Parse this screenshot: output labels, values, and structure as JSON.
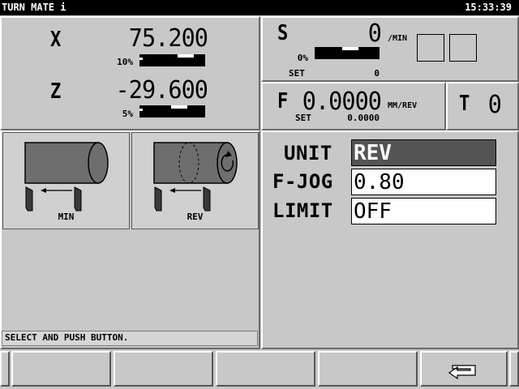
{
  "titlebar": {
    "app_title": "TURN MATE i",
    "clock": "15:33:39"
  },
  "position": {
    "x": {
      "label": "X",
      "value": "75.200",
      "override": "10%",
      "level": 0.7
    },
    "z": {
      "label": "Z",
      "value": "-29.600",
      "override": "5%",
      "level": 0.6
    }
  },
  "spindle": {
    "label": "S",
    "value": "0",
    "unit": "/MIN",
    "override": "0%",
    "set_label": "SET",
    "set_value": "0",
    "level": 0.55
  },
  "feed": {
    "label": "F",
    "value": "0.0000",
    "unit": "MM/REV",
    "set_label": "SET",
    "set_value": "0.0000"
  },
  "tool": {
    "label": "T",
    "value": "0"
  },
  "modes": [
    {
      "label": "MIN"
    },
    {
      "label": "REV"
    }
  ],
  "params": [
    {
      "label": "UNIT",
      "value": "REV"
    },
    {
      "label": "F-JOG",
      "value": "0.80"
    },
    {
      "label": "LIMIT",
      "value": "OFF"
    }
  ],
  "status_message": "SELECT AND PUSH BUTTON.",
  "softkeys": {
    "return_icon": "return-arrow-icon"
  },
  "colors": {
    "titlebar": "#000000",
    "selected_field": "#545454",
    "panel": "#c8c8c8"
  }
}
